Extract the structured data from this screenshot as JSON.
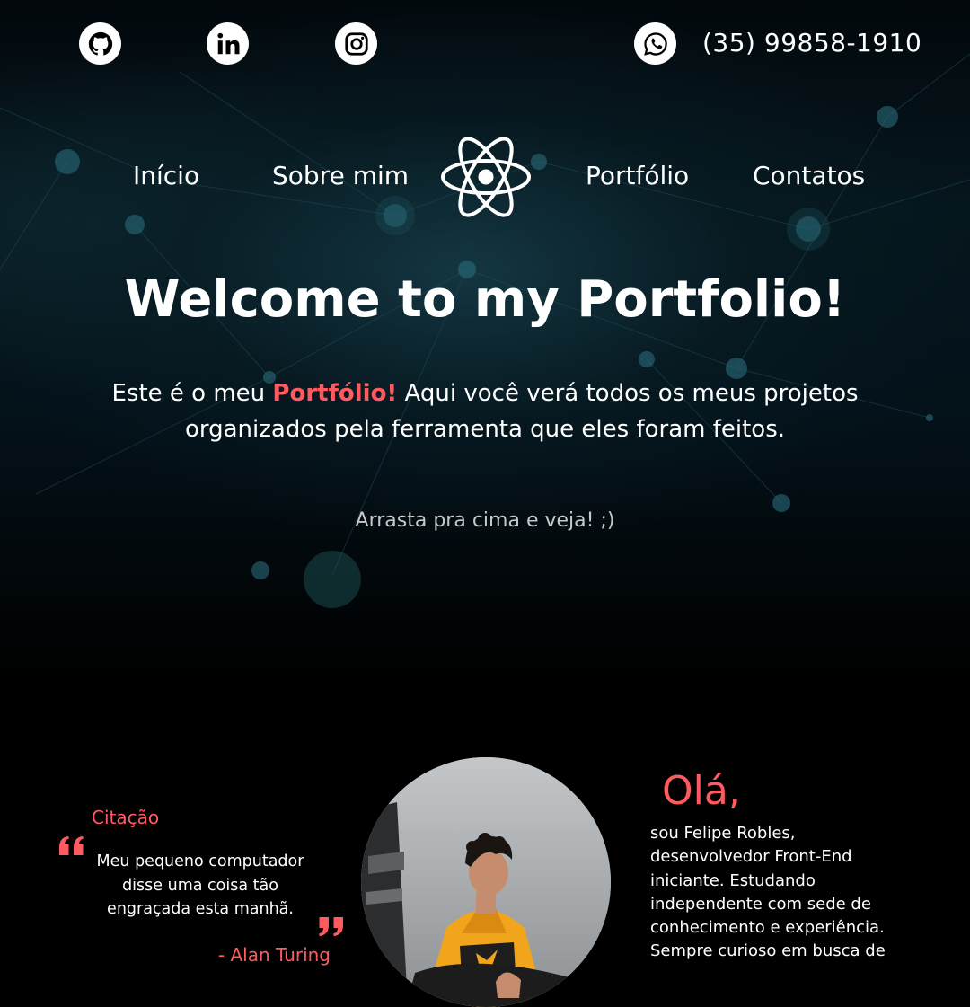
{
  "social": {
    "github_icon": "github-icon",
    "linkedin_icon": "linkedin-icon",
    "instagram_icon": "instagram-icon",
    "whatsapp_icon": "whatsapp-icon",
    "phone": "(35) 99858-1910"
  },
  "nav": {
    "items": [
      {
        "label": "Início"
      },
      {
        "label": "Sobre mim"
      },
      {
        "label": "Portfólio"
      },
      {
        "label": "Contatos"
      }
    ],
    "logo_icon": "react-icon"
  },
  "hero": {
    "title": "Welcome to my Portfolio!",
    "intro_before": "Este é o meu ",
    "intro_highlight": "Portfólio!",
    "intro_after": " Aqui você verá todos os meus projetos organizados pela ferramenta que eles foram feitos.",
    "hint": "Arrasta pra cima e veja! ;)"
  },
  "about": {
    "quote_title": "Citação",
    "quote_text": "Meu pequeno computador disse uma coisa tão engraçada esta manhã.",
    "quote_author": "- Alan Turing",
    "greeting": "Olá,",
    "bio": "sou Felipe Robles, desenvolvedor Front-End iniciante. Estudando independente com sede de conhecimento e experiência. Sempre curioso em busca de"
  },
  "colors": {
    "accent": "#ff5a5f",
    "background": "#000000",
    "text": "#ffffff"
  }
}
